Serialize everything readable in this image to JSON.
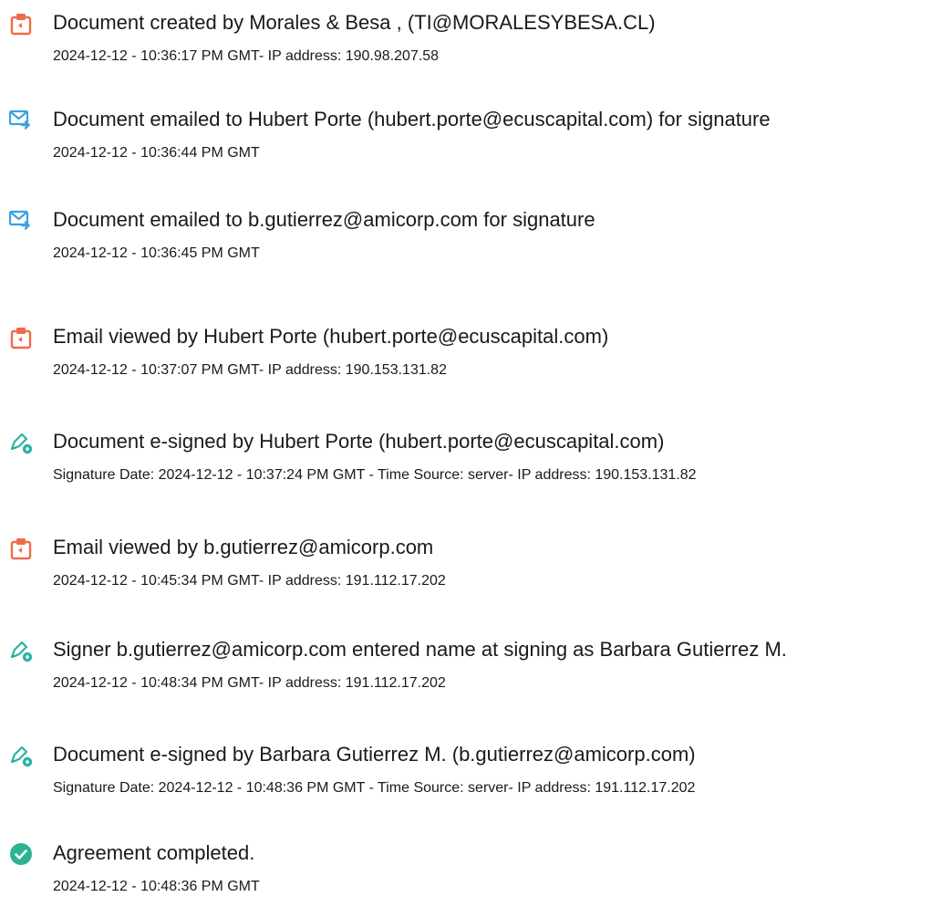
{
  "colors": {
    "doc_icon": "#ef6b4a",
    "email_icon": "#3aa0e6",
    "sign_icon": "#2bb3a0",
    "complete_icon": "#2db38f"
  },
  "events": [
    {
      "icon": "document-icon",
      "title": "Document created by Morales & Besa , (TI@MORALESYBESA.CL)",
      "detail": "2024-12-12 - 10:36:17 PM GMT- IP address: 190.98.207.58"
    },
    {
      "icon": "email-icon",
      "title": "Document emailed to Hubert Porte (hubert.porte@ecuscapital.com) for signature",
      "detail": "2024-12-12 - 10:36:44 PM GMT"
    },
    {
      "icon": "email-icon",
      "title": "Document emailed to b.gutierrez@amicorp.com for signature",
      "detail": "2024-12-12 - 10:36:45 PM GMT"
    },
    {
      "icon": "document-icon",
      "title": "Email viewed by Hubert Porte (hubert.porte@ecuscapital.com)",
      "detail": "2024-12-12 - 10:37:07 PM GMT- IP address: 190.153.131.82"
    },
    {
      "icon": "signature-icon",
      "title": "Document e-signed by Hubert Porte (hubert.porte@ecuscapital.com)",
      "detail": "Signature Date: 2024-12-12 - 10:37:24 PM GMT - Time Source: server- IP address: 190.153.131.82"
    },
    {
      "icon": "document-icon",
      "title": "Email viewed by b.gutierrez@amicorp.com",
      "detail": "2024-12-12 - 10:45:34 PM GMT- IP address: 191.112.17.202"
    },
    {
      "icon": "signature-icon",
      "title": "Signer b.gutierrez@amicorp.com entered name at signing as Barbara Gutierrez M.",
      "detail": "2024-12-12 - 10:48:34 PM GMT- IP address: 191.112.17.202"
    },
    {
      "icon": "signature-icon",
      "title": "Document e-signed by Barbara Gutierrez M. (b.gutierrez@amicorp.com)",
      "detail": "Signature Date: 2024-12-12 - 10:48:36 PM GMT - Time Source: server- IP address: 191.112.17.202"
    },
    {
      "icon": "checkmark-icon",
      "title": "Agreement completed.",
      "detail": "2024-12-12 - 10:48:36 PM GMT"
    }
  ]
}
